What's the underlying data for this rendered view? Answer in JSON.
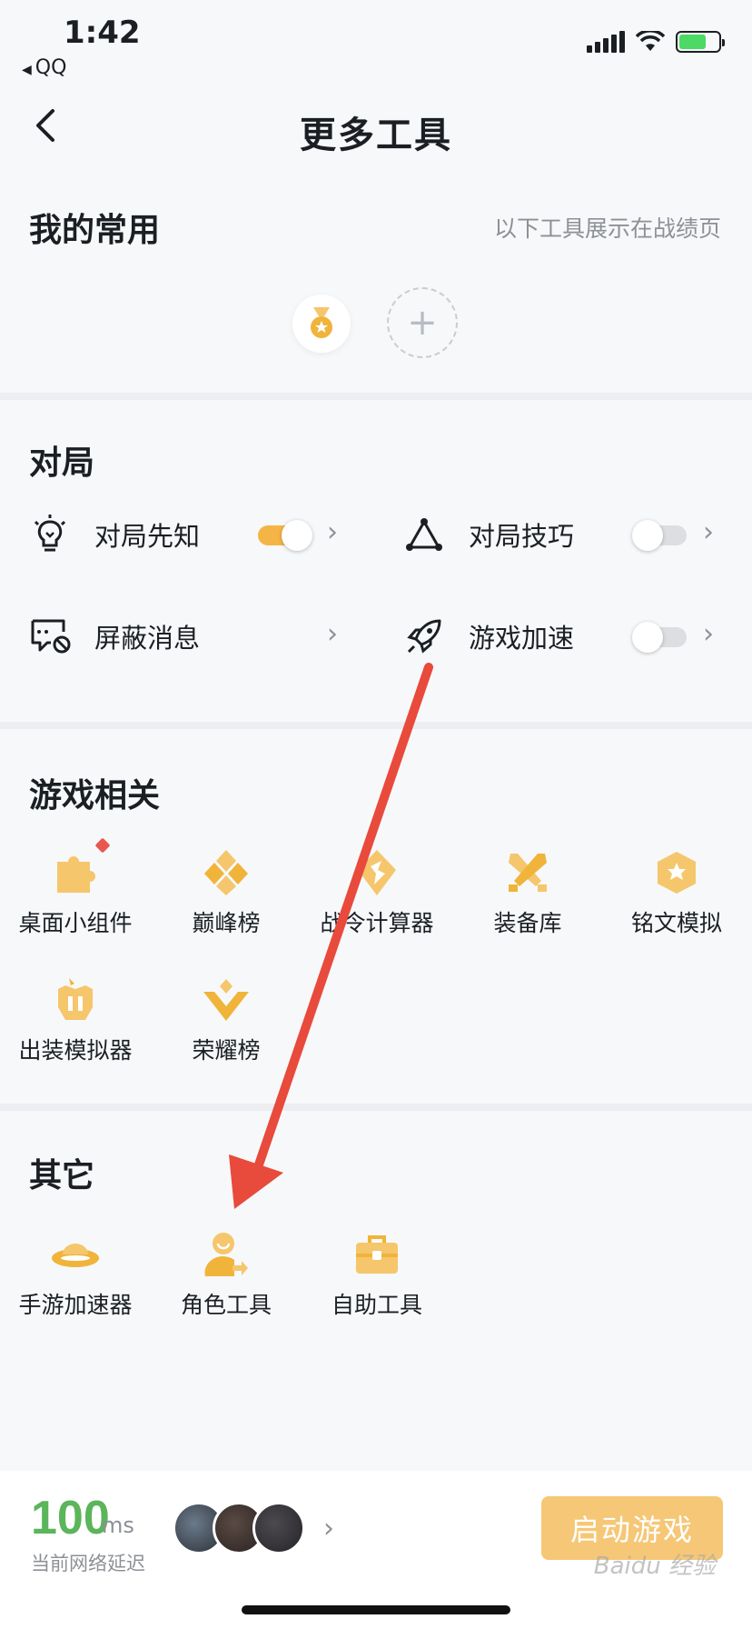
{
  "status_bar": {
    "time": "1:42",
    "back_app": "QQ"
  },
  "nav": {
    "title": "更多工具"
  },
  "favorites": {
    "heading": "我的常用",
    "hint": "以下工具展示在战绩页",
    "items": [
      {
        "icon": "medal-icon"
      }
    ],
    "add_label": "+"
  },
  "match": {
    "heading": "对局",
    "options": [
      {
        "label": "对局先知",
        "icon": "lightbulb-icon",
        "toggle": "on"
      },
      {
        "label": "对局技巧",
        "icon": "triangle-nodes-icon",
        "toggle": "off"
      },
      {
        "label": "屏蔽消息",
        "icon": "block-message-icon",
        "toggle": null
      },
      {
        "label": "游戏加速",
        "icon": "rocket-icon",
        "toggle": "off"
      }
    ]
  },
  "game": {
    "heading": "游戏相关",
    "items": [
      {
        "label": "桌面小组件",
        "icon": "puzzle-icon",
        "badge": true
      },
      {
        "label": "巅峰榜",
        "icon": "diamond-rank-icon"
      },
      {
        "label": "战令计算器",
        "icon": "battle-pass-icon"
      },
      {
        "label": "装备库",
        "icon": "crossed-swords-icon"
      },
      {
        "label": "铭文模拟",
        "icon": "hexagon-star-icon"
      },
      {
        "label": "出装模拟器",
        "icon": "armor-icon"
      },
      {
        "label": "荣耀榜",
        "icon": "glory-rank-icon"
      }
    ]
  },
  "other": {
    "heading": "其它",
    "items": [
      {
        "label": "手游加速器",
        "icon": "ufo-icon"
      },
      {
        "label": "角色工具",
        "icon": "role-transfer-icon"
      },
      {
        "label": "自助工具",
        "icon": "toolbox-icon"
      }
    ]
  },
  "footer": {
    "latency_value": "100",
    "latency_unit": "ms",
    "latency_label": "当前网络延迟",
    "launch_label": "启动游戏",
    "watermark": "Baidu 经验"
  },
  "colors": {
    "accent": "#f4b546",
    "icon": "#f5c66b",
    "latency_good": "#5bb55a",
    "annotation_arrow": "#e84a3c"
  }
}
